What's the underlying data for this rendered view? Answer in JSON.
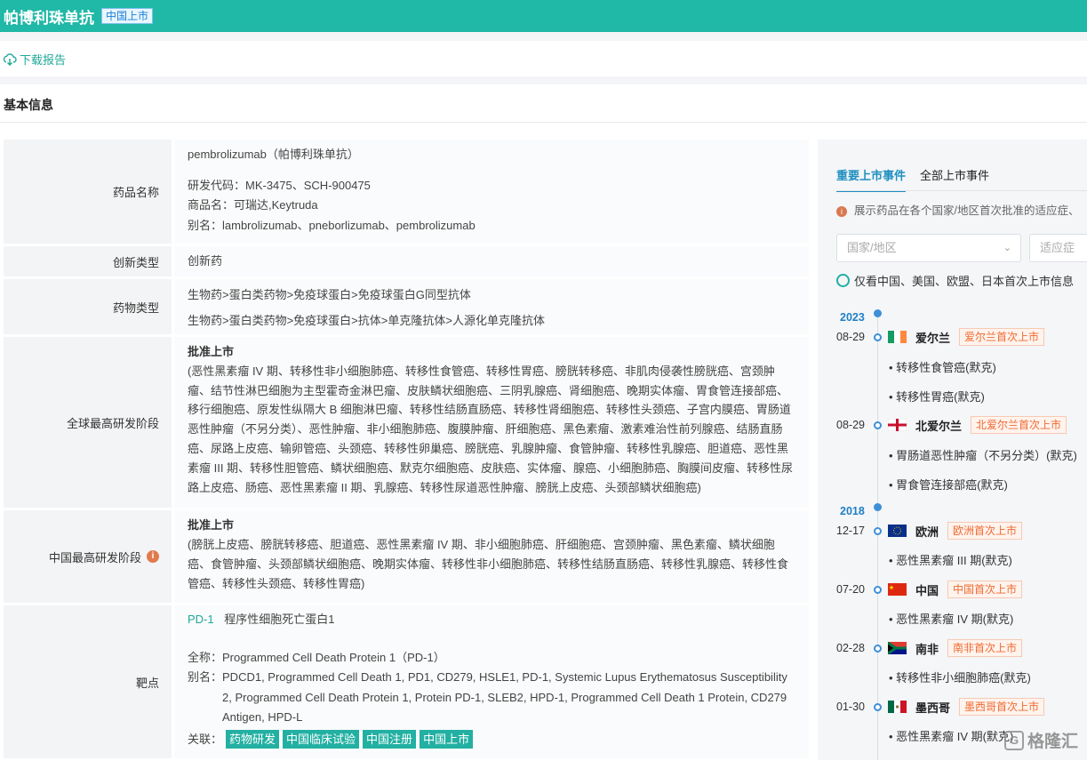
{
  "header": {
    "title": "帕博利珠单抗",
    "badge": "中国上市"
  },
  "toolbar": {
    "download_label": "下载报告"
  },
  "section": {
    "title": "基本信息"
  },
  "info": {
    "drug_name": {
      "label": "药品名称",
      "name": "pembrolizumab（帕博利珠单抗）",
      "code": "研发代码：MK-3475、SCH-900475",
      "trade": "商品名：可瑞达,Keytruda",
      "alias": "别名：lambrolizumab、pneborlizumab、pembrolizumab"
    },
    "innovation": {
      "label": "创新类型",
      "value": "创新药"
    },
    "drug_type": {
      "label": "药物类型",
      "line1": "生物药>蛋白类药物>免疫球蛋白>免疫球蛋白G同型抗体",
      "line2": "生物药>蛋白类药物>免疫球蛋白>抗体>单克隆抗体>人源化单克隆抗体"
    },
    "global_stage": {
      "label": "全球最高研发阶段",
      "status": "批准上市",
      "text": "(恶性黑素瘤 IV 期、转移性非小细胞肺癌、转移性食管癌、转移性胃癌、膀胱转移癌、非肌肉侵袭性膀胱癌、宫颈肿瘤、结节性淋巴细胞为主型霍奇金淋巴瘤、皮肤鳞状细胞癌、三阴乳腺癌、肾细胞癌、晚期实体瘤、胃食管连接部癌、移行细胞癌、原发性纵隔大 B 细胞淋巴瘤、转移性结肠直肠癌、转移性肾细胞癌、转移性头颈癌、子宫内膜癌、胃肠道恶性肿瘤（不另分类）、恶性肿瘤、非小细胞肺癌、腹膜肿瘤、肝细胞癌、黑色素瘤、激素难治性前列腺癌、结肠直肠癌、尿路上皮癌、输卵管癌、头颈癌、转移性卵巢癌、膀胱癌、乳腺肿瘤、食管肿瘤、转移性乳腺癌、胆道癌、恶性黑素瘤 III 期、转移性胆管癌、鳞状细胞癌、默克尔细胞癌、皮肤癌、实体瘤、腺癌、小细胞肺癌、胸膜间皮瘤、转移性尿路上皮癌、肠癌、恶性黑素瘤 II 期、乳腺癌、转移性尿道恶性肿瘤、膀胱上皮癌、头颈部鳞状细胞癌)"
    },
    "china_stage": {
      "label": "中国最高研发阶段",
      "status": "批准上市",
      "text": "(膀胱上皮癌、膀胱转移癌、胆道癌、恶性黑素瘤 IV 期、非小细胞肺癌、肝细胞癌、宫颈肿瘤、黑色素瘤、鳞状细胞癌、食管肿瘤、头颈部鳞状细胞癌、晚期实体瘤、转移性非小细胞肺癌、转移性结肠直肠癌、转移性乳腺癌、转移性食管癌、转移性头颈癌、转移性胃癌)"
    },
    "target": {
      "label": "靶点",
      "code": "PD-1",
      "name": "程序性细胞死亡蛋白1",
      "fullname": "全称：Programmed Cell Death Protein 1（PD-1）",
      "alias_label": "别名：",
      "alias": "PDCD1, Programmed Cell Death 1, PD1, CD279, HSLE1, PD-1, Systemic Lupus Erythematosus Susceptibility 2, Programmed Cell Death Protein 1, Protein PD-1, SLEB2, HPD-1, Programmed Cell Death 1 Protein, CD279 Antigen, HPD-L",
      "related_label": "关联：",
      "tags": [
        "药物研发",
        "中国临床试验",
        "中国注册",
        "中国上市"
      ]
    }
  },
  "panel": {
    "tabs": [
      "重要上市事件",
      "全部上市事件"
    ],
    "hint": "展示药品在各个国家/地区首次批准的适应症、",
    "country_placeholder": "国家/地区",
    "indication_placeholder": "适应症",
    "radio_label": "仅看中国、美国、欧盟、日本首次上市信息",
    "timeline": {
      "year_2023": "2023",
      "year_2018": "2018",
      "events": [
        {
          "date": "08-29",
          "country": "爱尔兰",
          "tag": "爱尔兰首次上市",
          "indications": [
            "转移性食管癌(默克)",
            "转移性胃癌(默克)"
          ]
        },
        {
          "date": "08-29",
          "country": "北爱尔兰",
          "tag": "北爱尔兰首次上市",
          "indications": [
            "胃肠道恶性肿瘤（不另分类）(默克)",
            "胃食管连接部癌(默克)"
          ]
        },
        {
          "date": "12-17",
          "country": "欧洲",
          "tag": "欧洲首次上市",
          "indications": [
            "恶性黑素瘤 III 期(默克)"
          ]
        },
        {
          "date": "07-20",
          "country": "中国",
          "tag": "中国首次上市",
          "indications": [
            "恶性黑素瘤 IV 期(默克)"
          ]
        },
        {
          "date": "02-28",
          "country": "南非",
          "tag": "南非首次上市",
          "indications": [
            "转移性非小细胞肺癌(默克)"
          ]
        },
        {
          "date": "01-30",
          "country": "墨西哥",
          "tag": "墨西哥首次上市",
          "indications": [
            "恶性黑素瘤 IV 期(默克)"
          ]
        }
      ]
    }
  },
  "watermark": "格隆汇"
}
